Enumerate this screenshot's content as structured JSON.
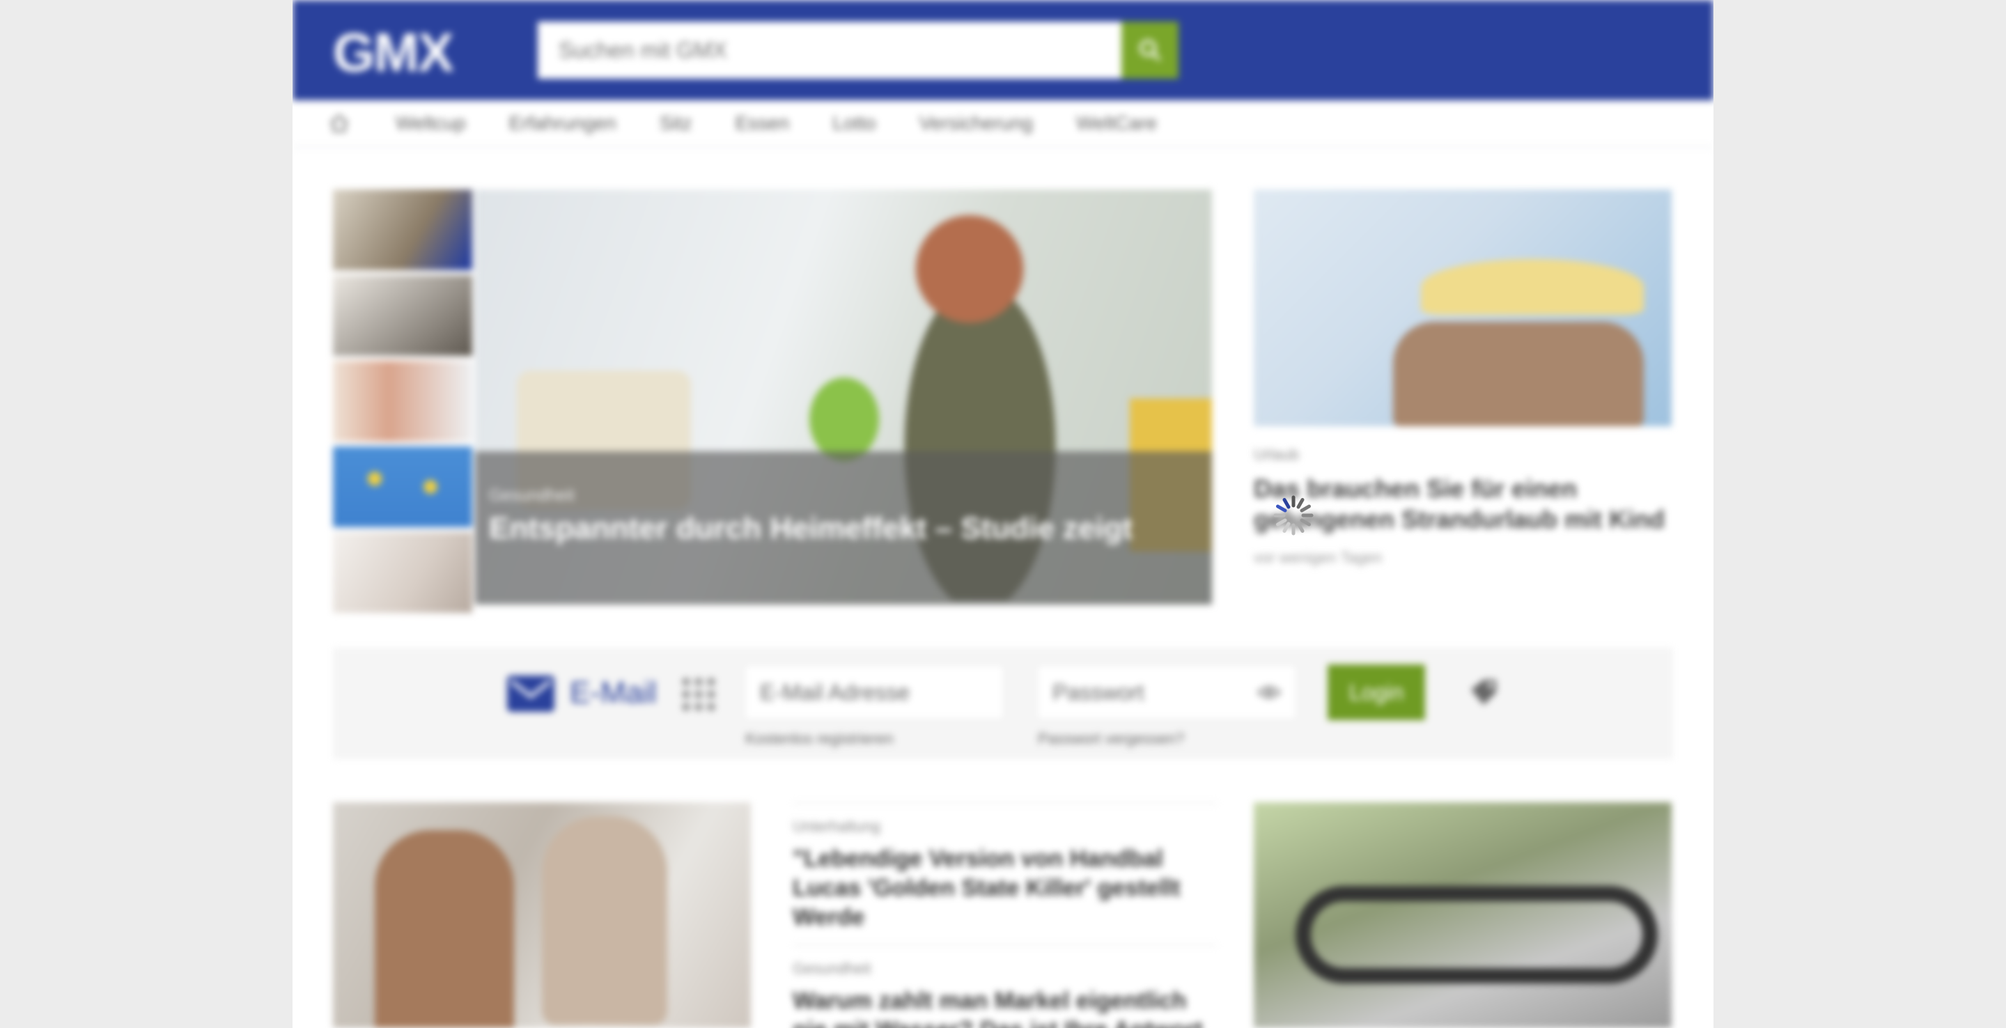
{
  "header": {
    "logo_text": "GMX",
    "search_placeholder": "Suchen mit GMX"
  },
  "nav": {
    "items": [
      "Weltcup",
      "Erfahrungen",
      "Sitz",
      "Essen",
      "Lotto",
      "Versicherung",
      "WeltCare"
    ]
  },
  "hero": {
    "kicker": "Gesundheit",
    "headline": "Entspannter durch Heimeffekt – Studie zeigt"
  },
  "side_article": {
    "kicker": "Urlaub",
    "title": "Das brauchen Sie für einen gelungenen Strandurlaub mit Kind",
    "meta": "vor wenigen Tagen"
  },
  "login": {
    "service_label": "E-Mail",
    "email_placeholder": "E-Mail Adresse",
    "password_placeholder": "Passwort",
    "login_button": "Login",
    "register_link": "Kostenlos registrieren",
    "forgot_link": "Passwort vergessen?"
  },
  "bottom_articles": [
    {
      "kicker": "Unterhaltung",
      "title": "\"Lebendige Version von Handbal Lucas 'Golden State Killer' gestellt Werde"
    },
    {
      "kicker": "Gesundheit",
      "title": "Warum zahlt man Markel eigentlich nie mit Wasser? Das ist Ihre Antwort"
    }
  ],
  "colors": {
    "brand_blue": "#2a419c",
    "accent_green": "#7aa62a",
    "login_green": "#6f9b23"
  }
}
